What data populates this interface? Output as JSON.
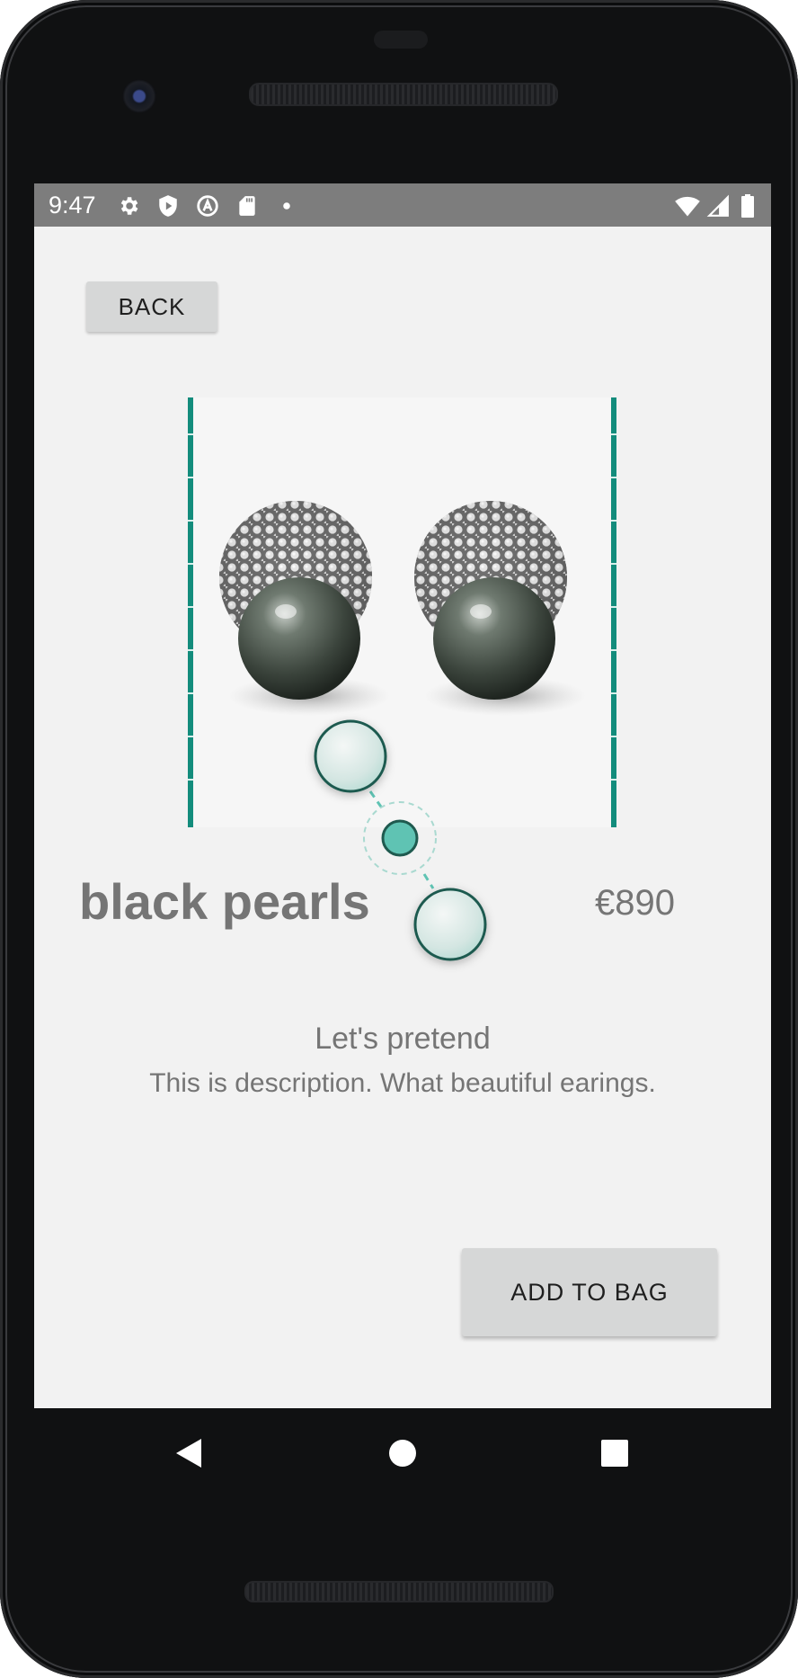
{
  "status_bar": {
    "time": "9:47",
    "left_icons": [
      "gear-icon",
      "shield-play-icon",
      "circle-a-icon",
      "sd-card-icon",
      "dot-icon"
    ],
    "right_icons": [
      "wifi-icon",
      "signal-icon",
      "battery-icon"
    ]
  },
  "toolbar": {
    "back_label": "BACK"
  },
  "product": {
    "image_alt": "black pearl earrings",
    "title": "black pearls",
    "price": "€890",
    "subtitle": "Let's pretend",
    "description": "This is description. What beautiful earings."
  },
  "actions": {
    "add_to_bag_label": "ADD TO BAG"
  },
  "colors": {
    "accent": "#138c7c",
    "handle_fill": "#5fc3b3",
    "screen_bg": "#f2f2f2",
    "status_bar_bg": "#7d7d7d",
    "text_gray": "#757575",
    "button_bg": "#d6d7d7"
  },
  "navigation": {
    "buttons": [
      "back-triangle-icon",
      "home-circle-icon",
      "recents-square-icon"
    ]
  }
}
